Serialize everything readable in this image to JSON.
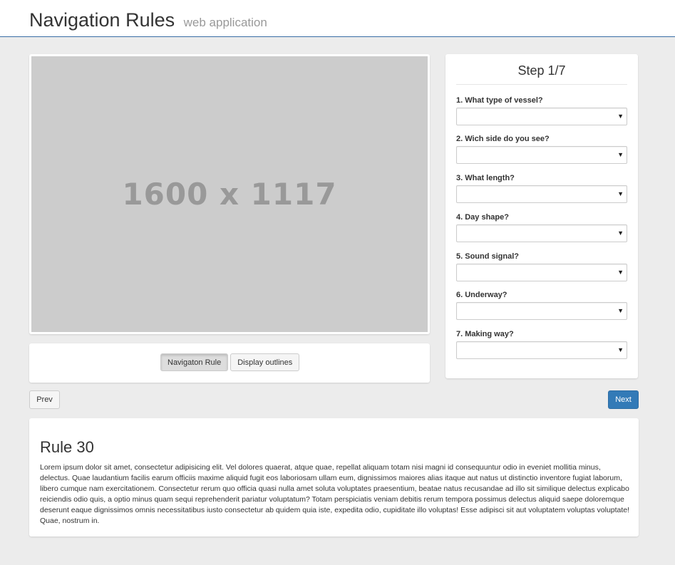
{
  "header": {
    "title": "Navigation Rules",
    "subtitle": "web application"
  },
  "image": {
    "placeholder_text": "1600 x 1117"
  },
  "view_buttons": {
    "navigation_rule": "Navigaton Rule",
    "display_outlines": "Display outlines"
  },
  "steps": {
    "title": "Step 1/7",
    "questions": [
      {
        "label": "1. What type of vessel?",
        "value": ""
      },
      {
        "label": "2. Wich side do you see?",
        "value": ""
      },
      {
        "label": "3. What length?",
        "value": ""
      },
      {
        "label": "4. Day shape?",
        "value": ""
      },
      {
        "label": "5. Sound signal?",
        "value": ""
      },
      {
        "label": "6. Underway?",
        "value": ""
      },
      {
        "label": "7. Making way?",
        "value": ""
      }
    ]
  },
  "pager": {
    "prev_label": "Prev",
    "next_label": "Next"
  },
  "rule": {
    "title": "Rule 30",
    "text": "Lorem ipsum dolor sit amet, consectetur adipisicing elit. Vel dolores quaerat, atque quae, repellat aliquam totam nisi magni id consequuntur odio in eveniet mollitia minus, delectus. Quae laudantium facilis earum officiis maxime aliquid fugit eos laboriosam ullam eum, dignissimos maiores alias itaque aut natus ut distinctio inventore fugiat laborum, libero cumque nam exercitationem. Consectetur rerum quo officia quasi nulla amet soluta voluptates praesentium, beatae natus recusandae ad illo sit similique delectus explicabo reiciendis odio quis, a optio minus quam sequi reprehenderit pariatur voluptatum? Totam perspiciatis veniam debitis rerum tempora possimus delectus aliquid saepe doloremque deserunt eaque dignissimos omnis necessitatibus iusto consectetur ab quidem quia iste, expedita odio, cupiditate illo voluptas! Esse adipisci sit aut voluptatem voluptas voluptate! Quae, nostrum in."
  },
  "colors": {
    "primary": "#337ab7",
    "header_border": "#3a6ea5",
    "placeholder_bg": "#cccccc"
  }
}
